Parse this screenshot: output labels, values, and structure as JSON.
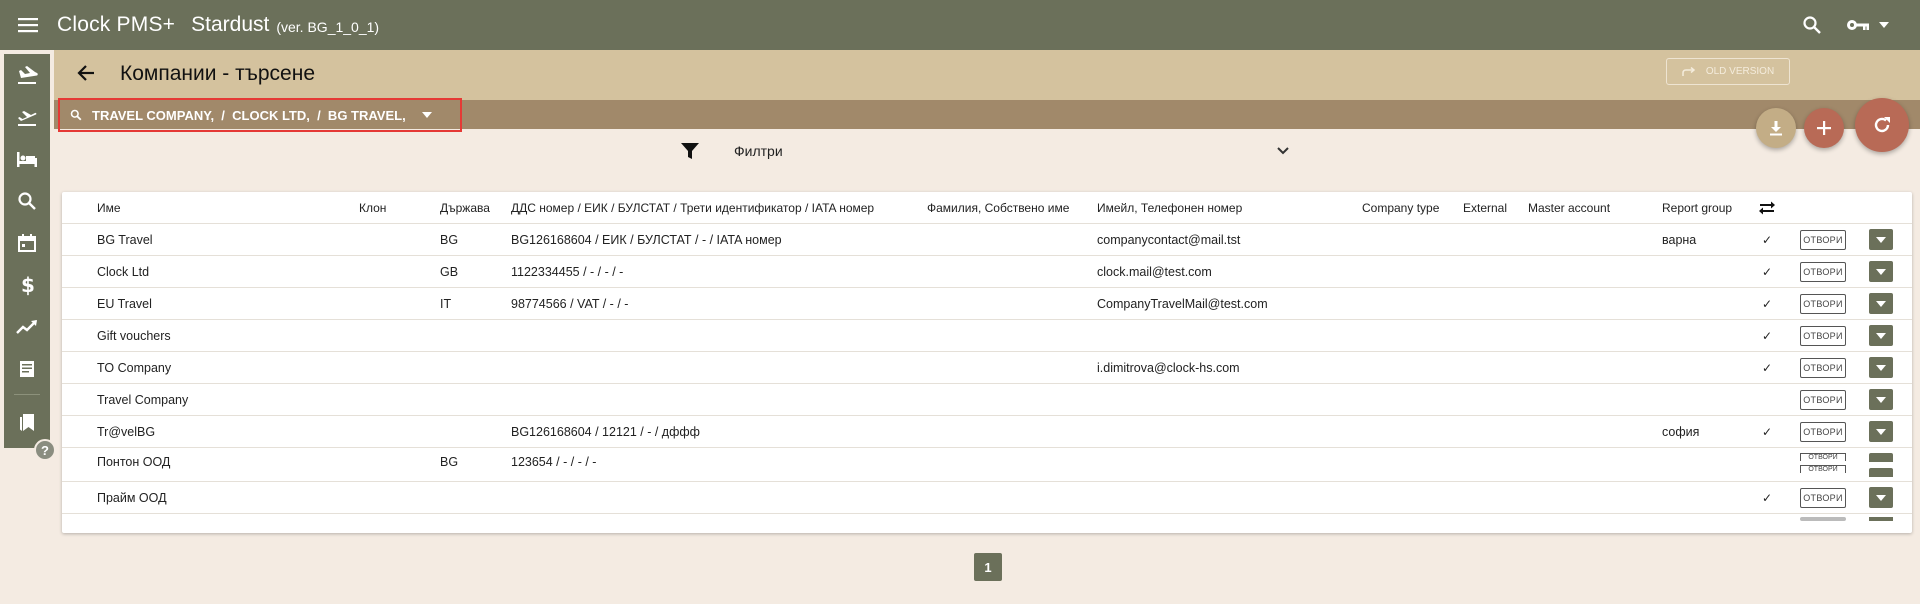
{
  "app": {
    "title": "Clock PMS+",
    "subtitle": "Stardust",
    "version": "(ver. BG_1_0_1)"
  },
  "page": {
    "title": "Компании - търсене",
    "old_version_label": "OLD VERSION"
  },
  "search": {
    "chips": "TRAVEL COMPANY,  /  CLOCK LTD,  /  BG TRAVEL,"
  },
  "filters": {
    "label": "Филтри"
  },
  "table": {
    "headers": {
      "name": "Име",
      "branch": "Клон",
      "country": "Държава",
      "vat": "ДДС номер / ЕИК / БУЛСТАТ / Трети идентификатор / IATA номер",
      "surname": "Фамилия, Собствено име",
      "email": "Имейл, Телефонен номер",
      "company_type": "Company type",
      "external": "External",
      "master_account": "Master account",
      "report_group": "Report group"
    },
    "open_label": "ОТВОРИ",
    "rows": [
      {
        "name": "BG Travel",
        "branch": "",
        "country": "BG",
        "vat": "BG126168604 / ЕИК / БУЛСТАТ / - / IATA номер",
        "surname": "",
        "email": "companycontact@mail.tst",
        "company_type": "",
        "external": "",
        "master_account": "",
        "report_group": "варна",
        "check": "✓"
      },
      {
        "name": "Clock Ltd",
        "branch": "",
        "country": "GB",
        "vat": "1122334455 / - / - / -",
        "surname": "",
        "email": "clock.mail@test.com",
        "company_type": "",
        "external": "",
        "master_account": "",
        "report_group": "",
        "check": "✓"
      },
      {
        "name": "EU Travel",
        "branch": "",
        "country": "IT",
        "vat": "98774566 / VAT / - / -",
        "surname": "",
        "email": "CompanyTravelMail@test.com",
        "company_type": "",
        "external": "",
        "master_account": "",
        "report_group": "",
        "check": "✓"
      },
      {
        "name": "Gift vouchers",
        "branch": "",
        "country": "",
        "vat": "",
        "surname": "",
        "email": "",
        "company_type": "",
        "external": "",
        "master_account": "",
        "report_group": "",
        "check": "✓"
      },
      {
        "name": "TO Company",
        "branch": "",
        "country": "",
        "vat": "",
        "surname": "",
        "email": "i.dimitrova@clock-hs.com",
        "company_type": "",
        "external": "",
        "master_account": "",
        "report_group": "",
        "check": "✓"
      },
      {
        "name": "Travel Company",
        "branch": "",
        "country": "",
        "vat": "",
        "surname": "",
        "email": "",
        "company_type": "",
        "external": "",
        "master_account": "",
        "report_group": "",
        "check": ""
      },
      {
        "name": "Tr@velBG",
        "branch": "",
        "country": "",
        "vat": "BG126168604 / 12121 / - / дффф",
        "surname": "",
        "email": "",
        "company_type": "",
        "external": "",
        "master_account": "",
        "report_group": "софия",
        "check": "✓"
      },
      {
        "name": "Понтон ООД",
        "branch": "",
        "country": "BG",
        "vat": "123654 / - / - / -",
        "surname": "",
        "email": "",
        "company_type": "",
        "external": "",
        "master_account": "",
        "report_group": "",
        "check": ""
      },
      {
        "name": "Прайм ООД",
        "branch": "",
        "country": "",
        "vat": "",
        "surname": "",
        "email": "",
        "company_type": "",
        "external": "",
        "master_account": "",
        "report_group": "",
        "check": "✓"
      }
    ]
  },
  "pagination": {
    "current": "1"
  },
  "sidebar": {
    "items": [
      "arrivals-icon",
      "departures-icon",
      "rooms-icon",
      "search-icon",
      "calendar-icon",
      "billing-icon",
      "reports-icon",
      "documents-icon",
      "bookmarks-icon"
    ]
  },
  "help_label": "?",
  "colors": {
    "topbar": "#6b705a",
    "title_band": "#d4c29e",
    "search_band": "#a1896a",
    "accent_fab": "#b86a56",
    "highlight_border": "#e53935",
    "background": "#f4ebe2"
  }
}
